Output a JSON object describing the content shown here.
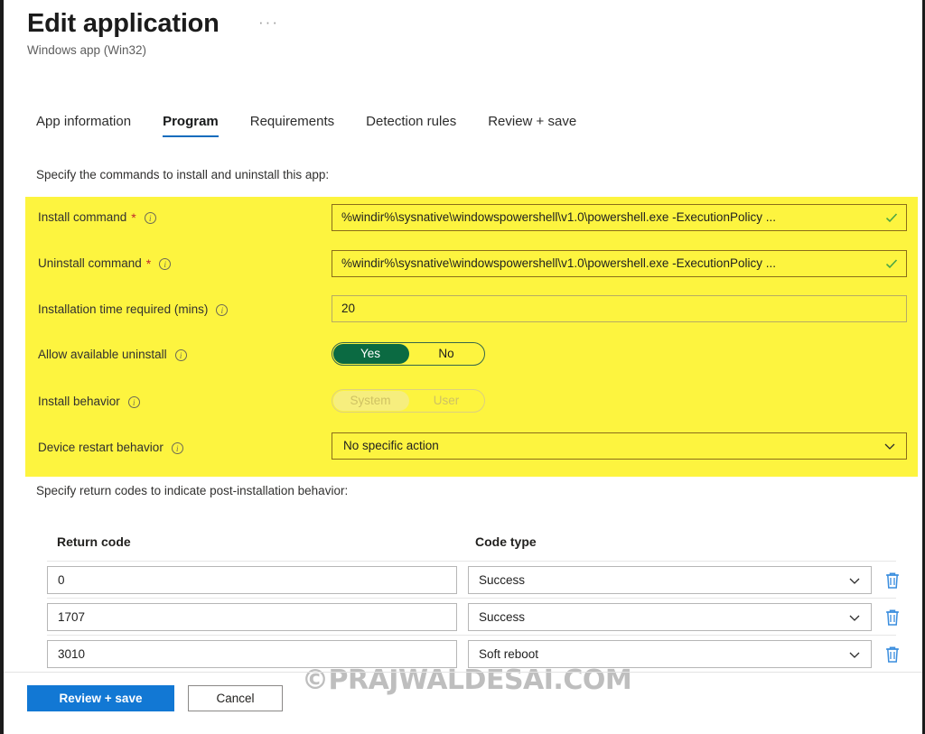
{
  "header": {
    "title": "Edit application",
    "ellipsis": "···",
    "subtitle": "Windows app (Win32)"
  },
  "tabs": [
    {
      "label": "App information",
      "active": false
    },
    {
      "label": "Program",
      "active": true
    },
    {
      "label": "Requirements",
      "active": false
    },
    {
      "label": "Detection rules",
      "active": false
    },
    {
      "label": "Review + save",
      "active": false
    }
  ],
  "sections": {
    "commands_caption": "Specify the commands to install and uninstall this app:",
    "returncodes_caption": "Specify return codes to indicate post-installation behavior:"
  },
  "program_form": {
    "install_command": {
      "label": "Install command",
      "required_marker": "*",
      "value": "%windir%\\sysnative\\windowspowershell\\v1.0\\powershell.exe -ExecutionPolicy ...",
      "valid": true
    },
    "uninstall_command": {
      "label": "Uninstall command",
      "required_marker": "*",
      "value": "%windir%\\sysnative\\windowspowershell\\v1.0\\powershell.exe -ExecutionPolicy ...",
      "valid": true
    },
    "installation_time": {
      "label": "Installation time required (mins)",
      "value": "20"
    },
    "allow_available_uninstall": {
      "label": "Allow available uninstall",
      "option_yes": "Yes",
      "option_no": "No",
      "selected": "Yes",
      "disabled": false
    },
    "install_behavior": {
      "label": "Install behavior",
      "option_system": "System",
      "option_user": "User",
      "selected": "System",
      "disabled": true
    },
    "device_restart_behavior": {
      "label": "Device restart behavior",
      "value": "No specific action"
    }
  },
  "return_codes": {
    "columns": [
      "Return code",
      "Code type"
    ],
    "rows": [
      {
        "code": "0",
        "type": "Success"
      },
      {
        "code": "1707",
        "type": "Success"
      },
      {
        "code": "3010",
        "type": "Soft reboot"
      }
    ]
  },
  "footer": {
    "primary_label": "Review + save",
    "secondary_label": "Cancel"
  },
  "watermark": {
    "text": "©PRAJWALDESAI.COM"
  },
  "colors": {
    "highlight": "#fdf43f",
    "accent_blue": "#0f6cbd",
    "primary_button": "#1278d4",
    "toggle_on": "#0b6a42",
    "required_star": "#c1272d",
    "valid_check": "#4aa544",
    "trash_icon": "#3a8dde"
  }
}
